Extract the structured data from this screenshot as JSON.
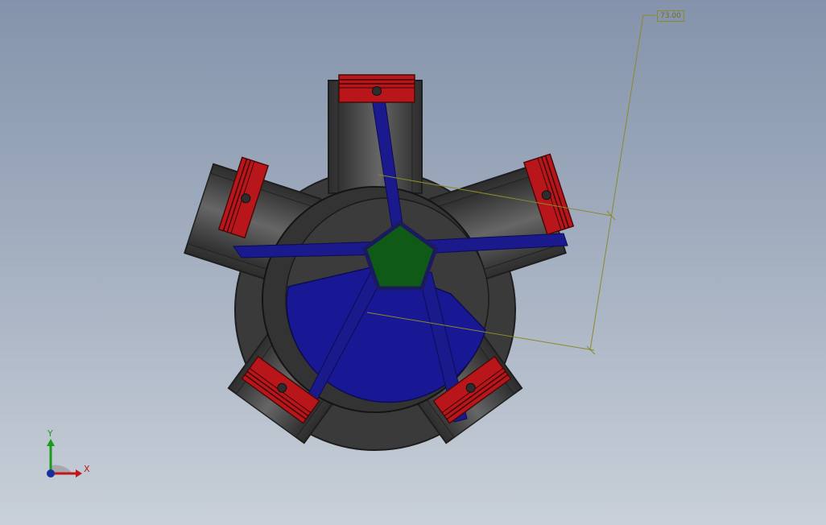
{
  "viewport": {
    "dimension_value": "73.00",
    "triad": {
      "x_label": "X",
      "y_label": "Y"
    }
  },
  "colors": {
    "background_top": "#8493ab",
    "background_bottom": "#c9d0d9",
    "engine_block": "#3c3c3c",
    "piston": "#c01a1a",
    "connecting_rod": "#1a1a8c",
    "crank_hub": "#0f5a17",
    "dimension_line": "#8a8a2a"
  },
  "icons": [
    "pin-icon",
    "triad-icon"
  ]
}
